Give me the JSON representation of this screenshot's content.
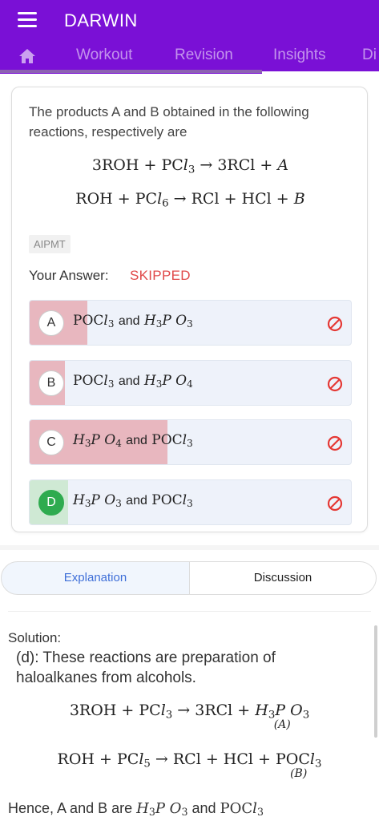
{
  "header": {
    "title": "DARWIN",
    "tabs": [
      {
        "label": "Workout"
      },
      {
        "label": "Revision"
      },
      {
        "label": "Insights"
      },
      {
        "label": "Di"
      }
    ],
    "accent": "#7a10d6"
  },
  "question": {
    "text": "The products A and B obtained in the following reactions, respectively are",
    "tag": "AIPMT",
    "answer_label": "Your Answer:",
    "answer_value": "SKIPPED",
    "options": [
      {
        "letter": "A",
        "fill_fraction": 0.18,
        "fill_color": "#e8b7bf"
      },
      {
        "letter": "B",
        "fill_fraction": 0.11,
        "fill_color": "#e8b7bf"
      },
      {
        "letter": "C",
        "fill_fraction": 0.43,
        "fill_color": "#e8b7bf"
      },
      {
        "letter": "D",
        "fill_fraction": 0.12,
        "fill_color": "#cfe9d4",
        "correct": true
      }
    ],
    "word_and": "and"
  },
  "explanation": {
    "tab_explanation": "Explanation",
    "tab_discussion": "Discussion",
    "solution_label": "Solution:",
    "solution_text": "(d): These reactions are preparation of haloalkanes from alcohols.",
    "hence_prefix": "Hence, A and B are",
    "hence_and": "and"
  },
  "colors": {
    "skip_icon": "#e53935",
    "correct_circle": "#2eab4f",
    "wrong_fill": "#e8b7bf",
    "explanation_link": "#3f6fd8"
  }
}
